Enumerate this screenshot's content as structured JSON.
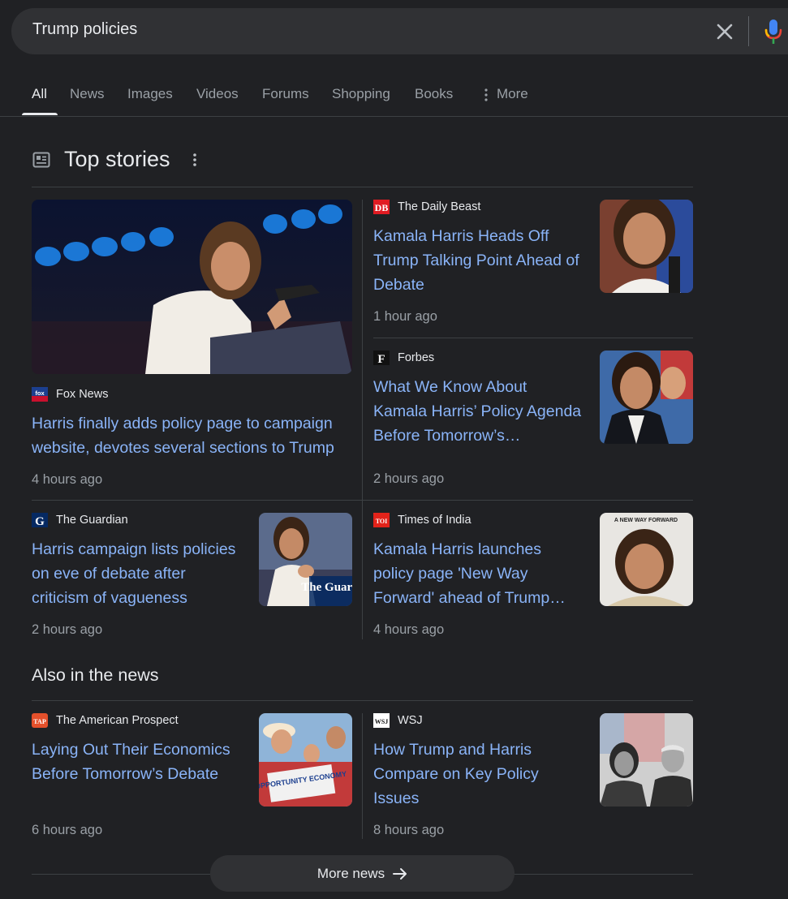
{
  "search": {
    "query": "Trump policies"
  },
  "tabs": [
    {
      "label": "All"
    },
    {
      "label": "News"
    },
    {
      "label": "Images"
    },
    {
      "label": "Videos"
    },
    {
      "label": "Forums"
    },
    {
      "label": "Shopping"
    },
    {
      "label": "Books"
    },
    {
      "label": "More"
    }
  ],
  "top_stories": {
    "title": "Top stories",
    "stories": [
      {
        "source": "Fox News",
        "headline": "Harris finally adds policy page to campaign website, devotes several sections to Trump",
        "time": "4 hours ago",
        "logo_text": "fox",
        "logo_color": "#1c3f8f"
      },
      {
        "source": "The Daily Beast",
        "headline": "Kamala Harris Heads Off Trump Talking Point Ahead of Debate",
        "time": "1 hour ago",
        "logo_text": "DB",
        "logo_color": "#e11b22"
      },
      {
        "source": "Forbes",
        "headline": "What We Know About Kamala Harris’ Policy Agenda Before Tomorrow’s…",
        "time": "2 hours ago",
        "logo_text": "F",
        "logo_color": "#111111"
      },
      {
        "source": "The Guardian",
        "headline": "Harris campaign lists policies on eve of debate after criticism of vagueness",
        "time": "2 hours ago",
        "logo_text": "G",
        "logo_color": "#052962"
      },
      {
        "source": "Times of India",
        "headline": "Kamala Harris launches policy page 'New Way Forward' ahead of Trump…",
        "time": "4 hours ago",
        "logo_text": "TOI",
        "logo_color": "#e2231a"
      }
    ]
  },
  "also_in_news": {
    "title": "Also in the news",
    "stories": [
      {
        "source": "The American Prospect",
        "headline": "Laying Out Their Economics Before Tomorrow’s Debate",
        "time": "6 hours ago",
        "logo_text": "TAP",
        "logo_color": "#e4502b"
      },
      {
        "source": "WSJ",
        "headline": "How Trump and Harris Compare on Key Policy Issues",
        "time": "8 hours ago",
        "logo_text": "WSJ",
        "logo_color": "#ffffff"
      }
    ]
  },
  "thumb_texts": {
    "guardian_watermark": "The Guardi",
    "toi_banner": "A NEW WAY FORWARD",
    "tap_sign": "OPPORTUNITY ECONOMY"
  },
  "more_news": {
    "label": "More news"
  },
  "colors": {
    "link": "#8ab4f8",
    "background": "#202124",
    "surface": "#303134",
    "muted": "#9aa0a6"
  }
}
